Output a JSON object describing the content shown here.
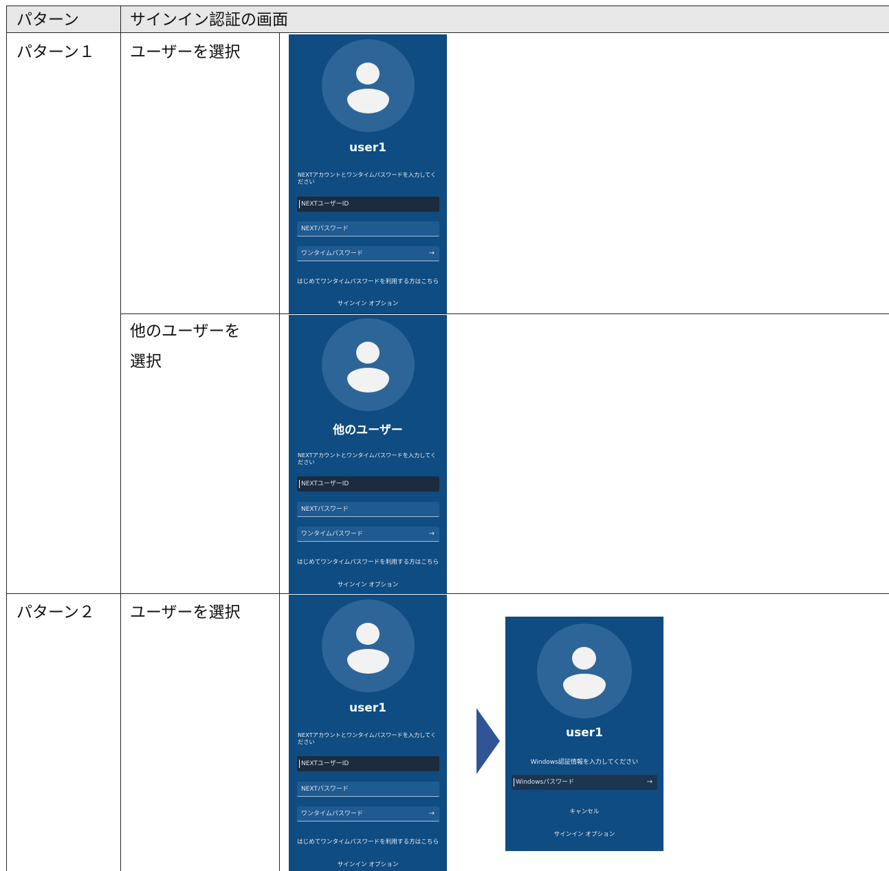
{
  "header": {
    "col1": "パターン",
    "col2": "サインイン認証の画面"
  },
  "rows": [
    {
      "pattern": "パターン１",
      "case": "ユーザーを選択"
    },
    {
      "case_line1": "他のユーザーを",
      "case_line2": "選択"
    },
    {
      "pattern": "パターン２",
      "case": "ユーザーを選択"
    }
  ],
  "panels": [
    {
      "username": "user1",
      "message": "NEXTアカウントとワンタイムパスワードを入力してください",
      "field_user_id": "NEXTユーザーID",
      "field_password": "NEXTパスワード",
      "field_otp": "ワンタイムパスワード",
      "first_time_link": "はじめてワンタイムパスワードを利用する方はこちら",
      "signin_options": "サインイン オプション"
    },
    {
      "username": "他のユーザー",
      "message": "NEXTアカウントとワンタイムパスワードを入力してください",
      "field_user_id": "NEXTユーザーID",
      "field_password": "NEXTパスワード",
      "field_otp": "ワンタイムパスワード",
      "first_time_link": "はじめてワンタイムパスワードを利用する方はこちら",
      "signin_options": "サインイン オプション"
    },
    {
      "username": "user1",
      "message": "NEXTアカウントとワンタイムパスワードを入力してください",
      "field_user_id": "NEXTユーザーID",
      "field_password": "NEXTパスワード",
      "field_otp": "ワンタイムパスワード",
      "first_time_link": "はじめてワンタイムパスワードを利用する方はこちら",
      "signin_options": "サインイン オプション"
    }
  ],
  "windows_panel": {
    "username": "user1",
    "message": "Windows認証情報を入力してください",
    "field_password": "Windowsパスワード",
    "cancel": "キャンセル",
    "signin_options": "サインイン オプション"
  },
  "icons": {
    "submit": "arrow-right-icon",
    "avatar": "user-avatar-icon",
    "transition": "transition-arrow-icon"
  },
  "colors": {
    "panel_bg": "#0f4c81",
    "header_bg": "#e7e7e7",
    "arrow": "#2f5597"
  }
}
